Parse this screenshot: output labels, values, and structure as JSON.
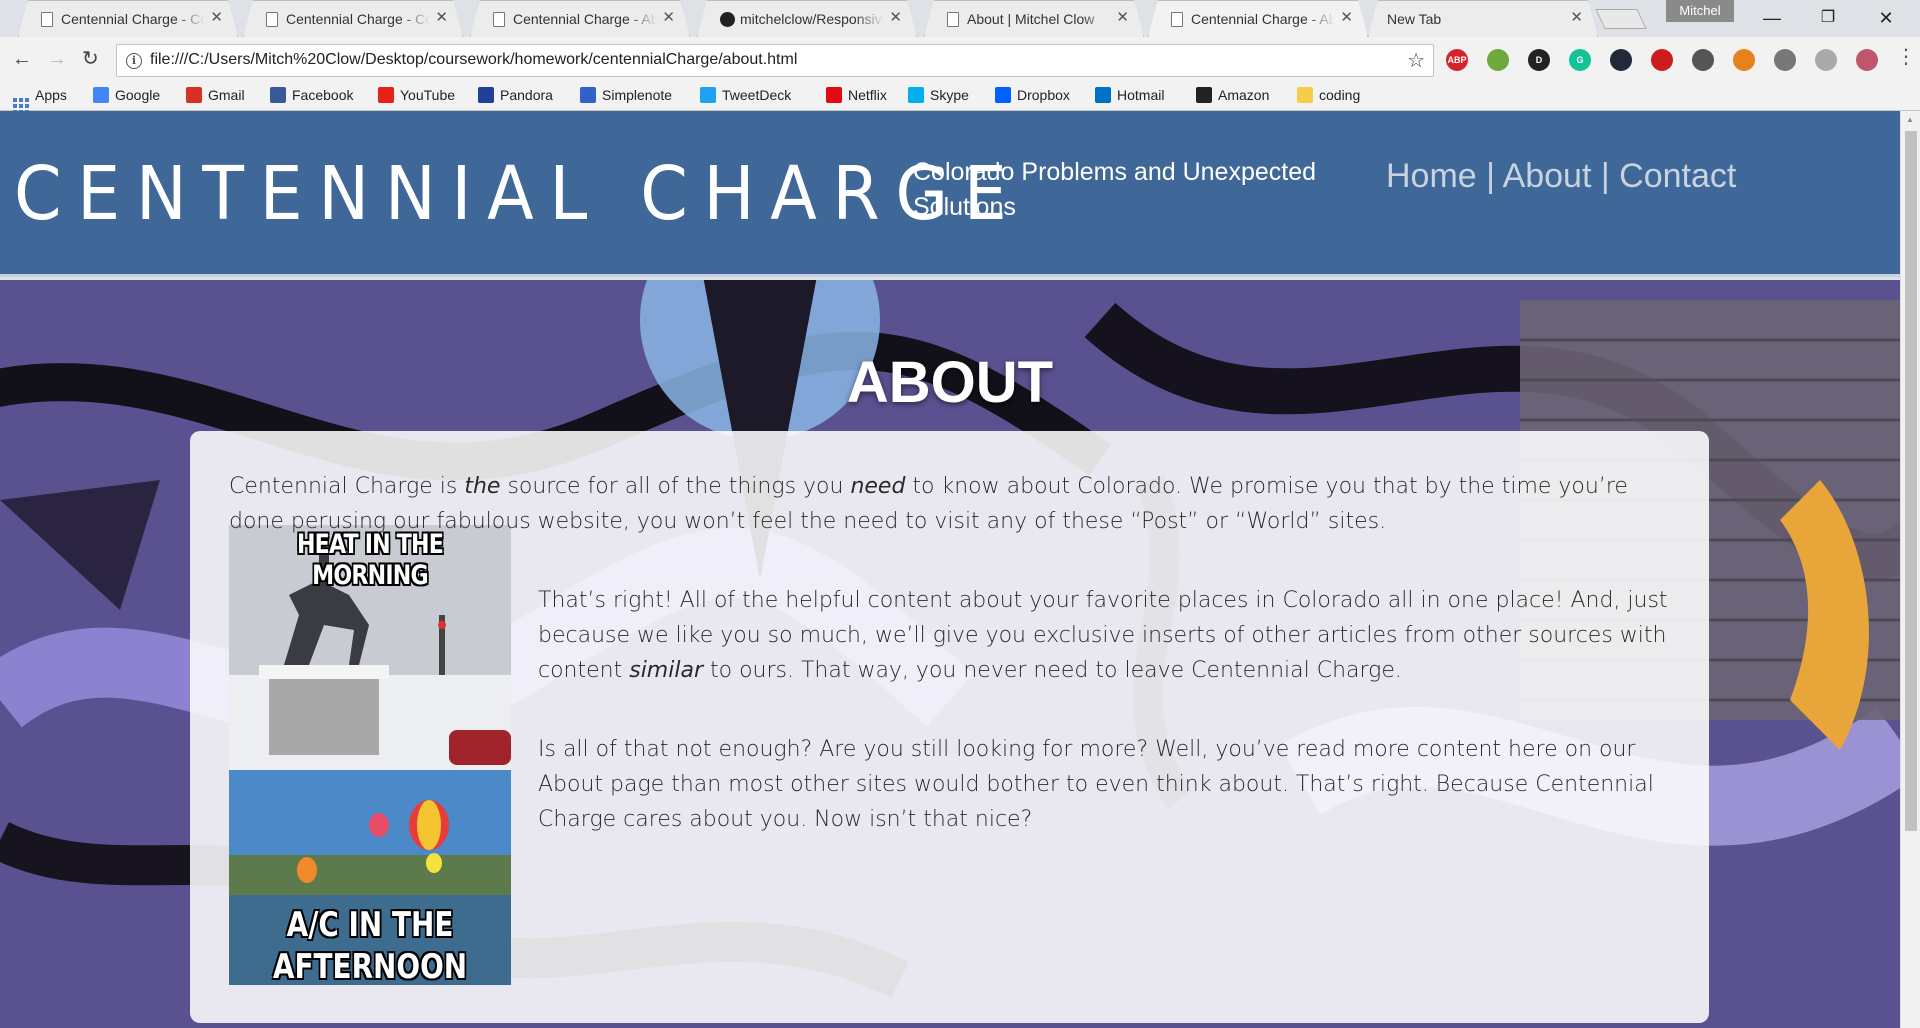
{
  "browser": {
    "tabs": [
      {
        "title": "Centennial Charge - Colorado Problems",
        "active": false
      },
      {
        "title": "Centennial Charge - Colorado Problems",
        "active": false
      },
      {
        "title": "Centennial Charge - About",
        "active": false
      },
      {
        "title": "mitchelclow/ResponsiveDesign",
        "active": false
      },
      {
        "title": "About | Mitchel Clow",
        "active": false
      },
      {
        "title": "Centennial Charge - About",
        "active": true
      },
      {
        "title": "New Tab",
        "active": false
      }
    ],
    "profile_name": "Mitchel",
    "url": "file:///C:/Users/Mitch%20Clow/Desktop/coursework/homework/centennialCharge/about.html",
    "extensions": [
      {
        "label": "ABP",
        "color": "#d4232b"
      },
      {
        "label": "",
        "color": "#6fa83b"
      },
      {
        "label": "D",
        "color": "#222222"
      },
      {
        "label": "G",
        "color": "#15c39a"
      },
      {
        "label": "",
        "color": "#222a3a"
      },
      {
        "label": "",
        "color": "#cc1c1c"
      },
      {
        "label": "",
        "color": "#555555"
      },
      {
        "label": "",
        "color": "#e6821e"
      },
      {
        "label": "",
        "color": "#777777"
      },
      {
        "label": "",
        "color": "#aaaaaa"
      },
      {
        "label": "",
        "color": "#c0566a"
      }
    ],
    "bookmarks": [
      {
        "label": "Apps",
        "icon": "apps-grid-icon",
        "color": "#4a7ad0"
      },
      {
        "label": "Google",
        "icon": "google-icon",
        "color": "#4285f4"
      },
      {
        "label": "Gmail",
        "icon": "gmail-icon",
        "color": "#d93025"
      },
      {
        "label": "Facebook",
        "icon": "facebook-icon",
        "color": "#3b5998"
      },
      {
        "label": "YouTube",
        "icon": "youtube-icon",
        "color": "#e62117"
      },
      {
        "label": "Pandora",
        "icon": "pandora-icon",
        "color": "#224099"
      },
      {
        "label": "Simplenote",
        "icon": "simplenote-icon",
        "color": "#3361cc"
      },
      {
        "label": "TweetDeck",
        "icon": "tweetdeck-icon",
        "color": "#1da1f2"
      },
      {
        "label": "Netflix",
        "icon": "netflix-icon",
        "color": "#e50914"
      },
      {
        "label": "Skype",
        "icon": "skype-icon",
        "color": "#00aff0"
      },
      {
        "label": "Dropbox",
        "icon": "dropbox-icon",
        "color": "#0061fe"
      },
      {
        "label": "Hotmail",
        "icon": "outlook-icon",
        "color": "#0072c6"
      },
      {
        "label": "Amazon",
        "icon": "amazon-icon",
        "color": "#222222"
      },
      {
        "label": "coding",
        "icon": "folder-icon",
        "color": "#f5cd47"
      }
    ]
  },
  "site": {
    "brand": "CENTENNIAL CHARGE",
    "tagline": "Colorado Problems and Unexpected Solutions",
    "nav": {
      "home": "Home",
      "sep1": " | ",
      "about": "About",
      "sep2": " | ",
      "contact": "Contact"
    },
    "header_color": "#3f6898",
    "page_title": "ABOUT",
    "meme": {
      "top_caption": "HEAT IN THE MORNING",
      "bottom_caption_1": "A/C IN THE",
      "bottom_caption_2": "AFTERNOON"
    },
    "paragraphs": {
      "p1_a": "Centennial Charge is ",
      "p1_em1": "the",
      "p1_b": " source for all of the things you ",
      "p1_em2": "need",
      "p1_c": " to know about Colorado. We promise you that by the time you’re done perusing our fabulous website, you won’t feel the need to visit any of these “Post” or “World” sites.",
      "p2_a": "That’s right! All of the helpful content about your favorite places in Colorado all in one place! And, just because we like you so much, we’ll give you exclusive inserts of other articles from other sources with content ",
      "p2_em": "similar",
      "p2_b": " to ours. That way, you never need to leave Centennial Charge.",
      "p3": "Is all of that not enough? Are you still looking for more? Well, you’ve read more content here on our About page than most other sites would bother to even think about. That’s right. Because Centennial Charge cares about you. Now isn’t that nice?"
    }
  }
}
